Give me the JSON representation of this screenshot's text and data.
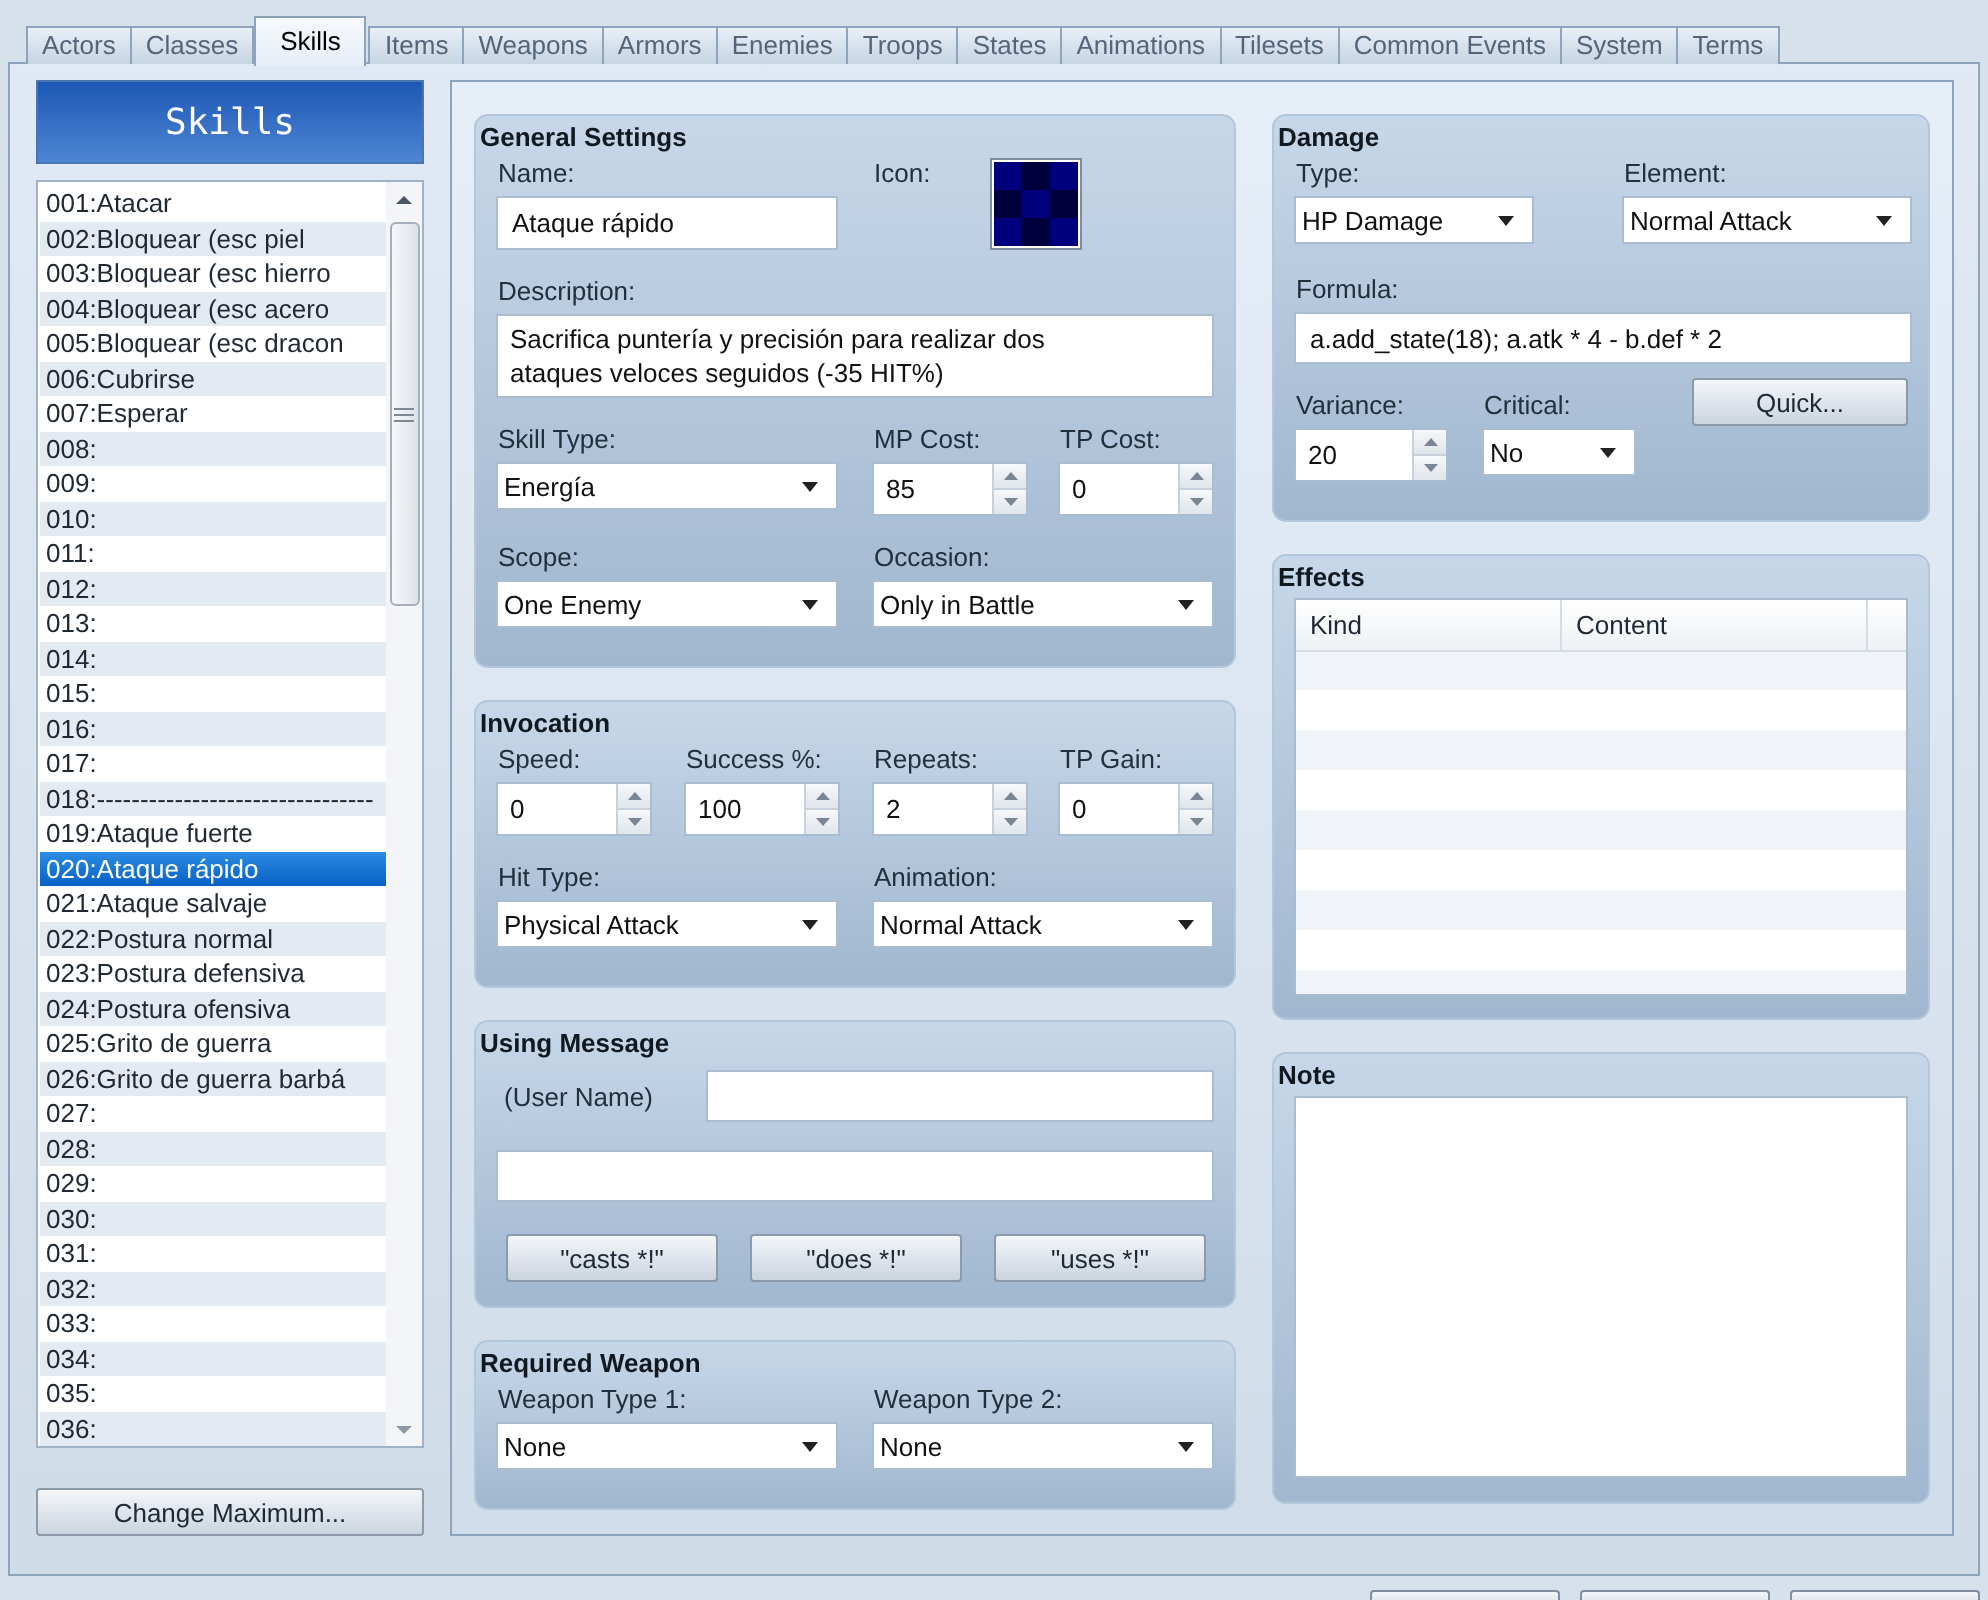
{
  "tabs": [
    {
      "label": "Actors",
      "selected": false
    },
    {
      "label": "Classes",
      "selected": false
    },
    {
      "label": "Skills",
      "selected": true
    },
    {
      "label": "Items",
      "selected": false
    },
    {
      "label": "Weapons",
      "selected": false
    },
    {
      "label": "Armors",
      "selected": false
    },
    {
      "label": "Enemies",
      "selected": false
    },
    {
      "label": "Troops",
      "selected": false
    },
    {
      "label": "States",
      "selected": false
    },
    {
      "label": "Animations",
      "selected": false
    },
    {
      "label": "Tilesets",
      "selected": false
    },
    {
      "label": "Common Events",
      "selected": false
    },
    {
      "label": "System",
      "selected": false
    },
    {
      "label": "Terms",
      "selected": false
    }
  ],
  "list_header": "Skills",
  "skill_list": [
    {
      "label": "001:Atacar",
      "selected": false
    },
    {
      "label": "002:Bloquear (esc piel",
      "selected": false
    },
    {
      "label": "003:Bloquear (esc hierro",
      "selected": false
    },
    {
      "label": "004:Bloquear (esc acero",
      "selected": false
    },
    {
      "label": "005:Bloquear (esc dracon",
      "selected": false
    },
    {
      "label": "006:Cubrirse",
      "selected": false
    },
    {
      "label": "007:Esperar",
      "selected": false
    },
    {
      "label": "008:",
      "selected": false
    },
    {
      "label": "009:",
      "selected": false
    },
    {
      "label": "010:",
      "selected": false
    },
    {
      "label": "011:",
      "selected": false
    },
    {
      "label": "012:",
      "selected": false
    },
    {
      "label": "013:",
      "selected": false
    },
    {
      "label": "014:",
      "selected": false
    },
    {
      "label": "015:",
      "selected": false
    },
    {
      "label": "016:",
      "selected": false
    },
    {
      "label": "017:",
      "selected": false
    },
    {
      "label": "018:--------------------------------",
      "selected": false
    },
    {
      "label": "019:Ataque fuerte",
      "selected": false
    },
    {
      "label": "020:Ataque rápido",
      "selected": true
    },
    {
      "label": "021:Ataque salvaje",
      "selected": false
    },
    {
      "label": "022:Postura normal",
      "selected": false
    },
    {
      "label": "023:Postura defensiva",
      "selected": false
    },
    {
      "label": "024:Postura ofensiva",
      "selected": false
    },
    {
      "label": "025:Grito de guerra",
      "selected": false
    },
    {
      "label": "026:Grito de guerra barbá",
      "selected": false
    },
    {
      "label": "027:",
      "selected": false
    },
    {
      "label": "028:",
      "selected": false
    },
    {
      "label": "029:",
      "selected": false
    },
    {
      "label": "030:",
      "selected": false
    },
    {
      "label": "031:",
      "selected": false
    },
    {
      "label": "032:",
      "selected": false
    },
    {
      "label": "033:",
      "selected": false
    },
    {
      "label": "034:",
      "selected": false
    },
    {
      "label": "035:",
      "selected": false
    },
    {
      "label": "036:",
      "selected": false
    }
  ],
  "change_maximum_button": "Change Maximum...",
  "general_settings": {
    "title": "General Settings",
    "fields": [
      {
        "kind": "text",
        "label": "Name:",
        "value": "Ataque rápido"
      },
      {
        "kind": "icon",
        "label": "Icon:"
      },
      {
        "kind": "textarea",
        "label": "Description:",
        "value": "Sacrifica puntería y precisión para realizar dos ataques veloces seguidos (-35 HIT%)"
      },
      {
        "kind": "dropdown",
        "label": "Skill Type:",
        "value": "Energía"
      },
      {
        "kind": "spinner",
        "label": "MP Cost:",
        "value": "85"
      },
      {
        "kind": "spinner",
        "label": "TP Cost:",
        "value": "0"
      },
      {
        "kind": "dropdown",
        "label": "Scope:",
        "value": "One Enemy"
      },
      {
        "kind": "dropdown",
        "label": "Occasion:",
        "value": "Only in Battle"
      }
    ]
  },
  "invocation": {
    "title": "Invocation",
    "fields": [
      {
        "kind": "spinner",
        "label": "Speed:",
        "value": "0"
      },
      {
        "kind": "spinner",
        "label": "Success %:",
        "value": "100"
      },
      {
        "kind": "spinner",
        "label": "Repeats:",
        "value": "2"
      },
      {
        "kind": "spinner",
        "label": "TP Gain:",
        "value": "0"
      },
      {
        "kind": "dropdown",
        "label": "Hit Type:",
        "value": "Physical Attack"
      },
      {
        "kind": "dropdown",
        "label": "Animation:",
        "value": "Normal Attack"
      }
    ]
  },
  "using_message": {
    "title": "Using Message",
    "user_name_label": "(User Name)",
    "buttons": [
      "\"casts *!\"",
      "\"does *!\"",
      "\"uses *!\""
    ]
  },
  "required_weapon": {
    "title": "Required Weapon",
    "fields": [
      {
        "kind": "dropdown",
        "label": "Weapon Type 1:",
        "value": "None"
      },
      {
        "kind": "dropdown",
        "label": "Weapon Type 2:",
        "value": "None"
      }
    ]
  },
  "damage": {
    "title": "Damage",
    "fields": [
      {
        "kind": "dropdown",
        "label": "Type:",
        "value": "HP Damage"
      },
      {
        "kind": "dropdown",
        "label": "Element:",
        "value": "Normal Attack"
      },
      {
        "kind": "text",
        "label": "Formula:",
        "value": "a.add_state(18); a.atk * 4 - b.def * 2"
      },
      {
        "kind": "spinner",
        "label": "Variance:",
        "value": "20"
      },
      {
        "kind": "dropdown",
        "label": "Critical:",
        "value": "No"
      }
    ],
    "quick_button": "Quick..."
  },
  "effects": {
    "title": "Effects",
    "columns": [
      "Kind",
      "Content"
    ]
  },
  "note": {
    "title": "Note"
  }
}
